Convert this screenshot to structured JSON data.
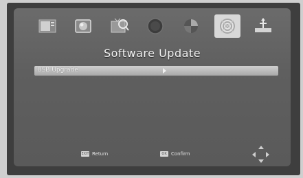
{
  "toolbar": {
    "icons": [
      {
        "name": "installation-icon",
        "active": false
      },
      {
        "name": "picture-icon",
        "active": false
      },
      {
        "name": "channel-search-icon",
        "active": false
      },
      {
        "name": "time-icon",
        "active": false
      },
      {
        "name": "option-icon",
        "active": false
      },
      {
        "name": "system-icon",
        "active": true
      },
      {
        "name": "usb-icon",
        "active": false
      }
    ]
  },
  "page": {
    "title": "Software Update"
  },
  "menu": {
    "items": [
      {
        "label": "USB Upgrade",
        "selected": true
      }
    ]
  },
  "footer": {
    "return_key": "EXIT",
    "return_label": "Return",
    "confirm_key": "OK",
    "confirm_label": "Confirm"
  },
  "colors": {
    "screen_bg": "#5f5f5f",
    "highlight": "#cfcfcf",
    "text": "#f4f4f4"
  }
}
